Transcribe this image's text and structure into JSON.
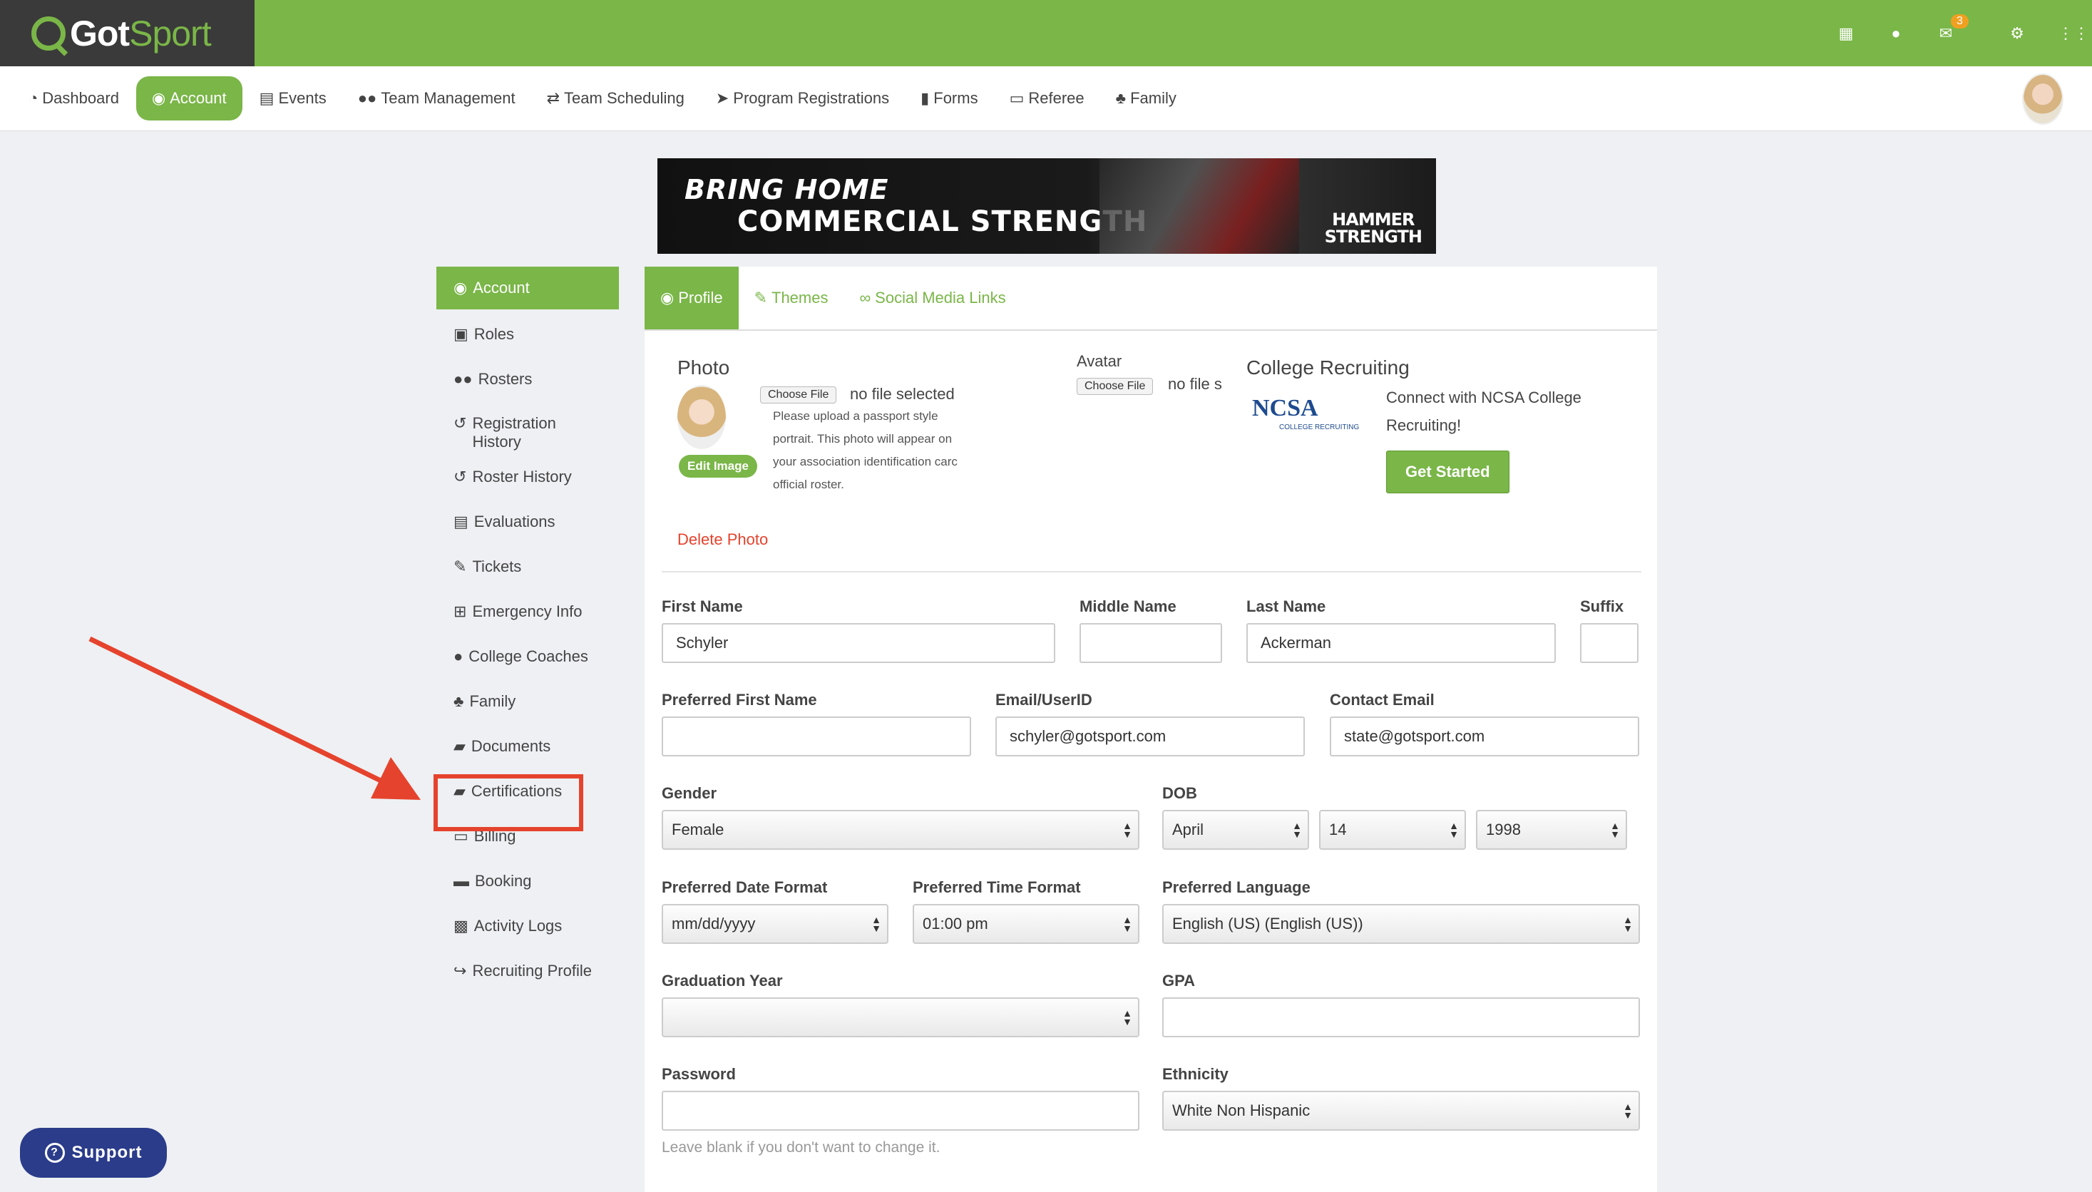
{
  "brand": {
    "logo_main": "Got",
    "logo_accent": "Sport"
  },
  "topbar": {
    "messages_badge": "3"
  },
  "nav": {
    "items": [
      {
        "label": "Dashboard",
        "icon": "tachometer-icon"
      },
      {
        "label": "Account",
        "icon": "user-circle-icon"
      },
      {
        "label": "Events",
        "icon": "calendar-icon"
      },
      {
        "label": "Team Management",
        "icon": "users-icon"
      },
      {
        "label": "Team Scheduling",
        "icon": "exchange-icon"
      },
      {
        "label": "Program Registrations",
        "icon": "paper-plane-icon"
      },
      {
        "label": "Forms",
        "icon": "file-icon"
      },
      {
        "label": "Referee",
        "icon": "calendar-o-icon"
      },
      {
        "label": "Family",
        "icon": "sitemap-icon"
      }
    ],
    "active": "Account"
  },
  "banner": {
    "line1": "BRING HOME",
    "line2": "COMMERCIAL STRENGTH",
    "brand_line1": "HAMMER",
    "brand_line2": "STRENGTH"
  },
  "side_menu": {
    "items": [
      {
        "label": "Account"
      },
      {
        "label": "Roles"
      },
      {
        "label": "Rosters"
      },
      {
        "label": "Registration History"
      },
      {
        "label": "Roster History"
      },
      {
        "label": "Evaluations"
      },
      {
        "label": "Tickets"
      },
      {
        "label": "Emergency Info"
      },
      {
        "label": "College Coaches"
      },
      {
        "label": "Family"
      },
      {
        "label": "Documents"
      },
      {
        "label": "Certifications"
      },
      {
        "label": "Billing"
      },
      {
        "label": "Booking"
      },
      {
        "label": "Activity Logs"
      },
      {
        "label": "Recruiting Profile"
      }
    ],
    "highlighted": "Certifications"
  },
  "tabs": [
    {
      "label": "Profile"
    },
    {
      "label": "Themes"
    },
    {
      "label": "Social Media Links"
    }
  ],
  "photo": {
    "title": "Photo",
    "choose_file": "Choose File",
    "no_file": "no file selected",
    "help": "Please upload a passport style portrait. This photo will appear on your association identification carc official roster.",
    "help_lines": [
      "Please upload a passport style",
      "portrait. This photo will appear on",
      "your association identification carc",
      "official roster."
    ],
    "edit_image": "Edit Image",
    "delete": "Delete Photo"
  },
  "avatar": {
    "title": "Avatar",
    "choose_file": "Choose File",
    "no_file": "no file s"
  },
  "recruiting": {
    "title": "College Recruiting",
    "logo": "NCSA",
    "logo_sub": "COLLEGE RECRUITING",
    "text_line1": "Connect with NCSA College",
    "text_line2": "Recruiting!",
    "button": "Get Started"
  },
  "form": {
    "first_name": {
      "label": "First Name",
      "value": "Schyler"
    },
    "middle_name": {
      "label": "Middle Name",
      "value": ""
    },
    "last_name": {
      "label": "Last Name",
      "value": "Ackerman"
    },
    "suffix": {
      "label": "Suffix",
      "value": ""
    },
    "preferred_first_name": {
      "label": "Preferred First Name",
      "value": ""
    },
    "email": {
      "label": "Email/UserID",
      "value": "schyler@gotsport.com"
    },
    "contact_email": {
      "label": "Contact Email",
      "value": "state@gotsport.com"
    },
    "gender": {
      "label": "Gender",
      "value": "Female"
    },
    "dob": {
      "label": "DOB",
      "month": "April",
      "day": "14",
      "year": "1998"
    },
    "date_format": {
      "label": "Preferred Date Format",
      "value": "mm/dd/yyyy"
    },
    "time_format": {
      "label": "Preferred Time Format",
      "value": "01:00 pm"
    },
    "language": {
      "label": "Preferred Language",
      "value": "English (US) (English (US))"
    },
    "graduation_year": {
      "label": "Graduation Year",
      "value": ""
    },
    "gpa": {
      "label": "GPA",
      "value": ""
    },
    "password": {
      "label": "Password",
      "value": "",
      "hint": "Leave blank if you don't want to change it."
    },
    "ethnicity": {
      "label": "Ethnicity",
      "value": "White Non Hispanic"
    }
  },
  "support": {
    "label": "Support"
  },
  "colors": {
    "primary": "#7ab648",
    "dark": "#3a3a3a",
    "highlight": "#e5432d",
    "support": "#2a3c8a"
  }
}
